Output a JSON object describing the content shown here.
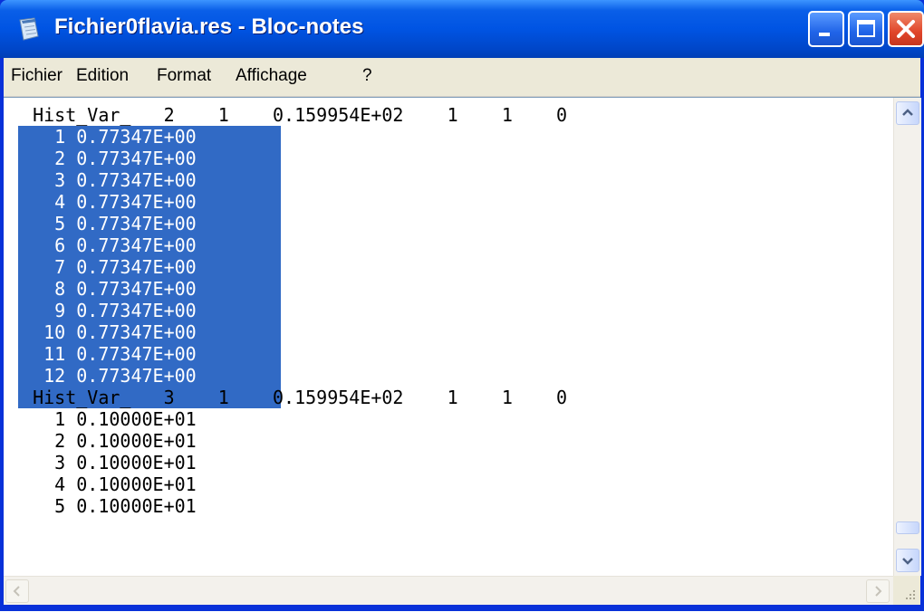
{
  "window": {
    "title": "Fichier0flavia.res - Bloc-notes",
    "controls": [
      "minimize",
      "maximize",
      "close"
    ]
  },
  "menu": {
    "items": [
      "Fichier",
      "Edition",
      "Format",
      "Affichage",
      "?"
    ]
  },
  "editor": {
    "lines": [
      "  Hist_Var_   2    1    0.159954E+02    1    1    0",
      "    1 0.77347E+00",
      "    2 0.77347E+00",
      "    3 0.77347E+00",
      "    4 0.77347E+00",
      "    5 0.77347E+00",
      "    6 0.77347E+00",
      "    7 0.77347E+00",
      "    8 0.77347E+00",
      "    9 0.77347E+00",
      "   10 0.77347E+00",
      "   11 0.77347E+00",
      "   12 0.77347E+00",
      "  Hist_Var_   3    1    0.159954E+02    1    1    0",
      "    1 0.10000E+01",
      "    2 0.10000E+01",
      "    3 0.10000E+01",
      "    4 0.10000E+01",
      "    5 0.10000E+01"
    ],
    "selected_line_indices": [
      1,
      2,
      3,
      4,
      5,
      6,
      7,
      8,
      9,
      10,
      11,
      12
    ]
  },
  "colors": {
    "selection_bg": "#316ac5",
    "selection_text": "#ffffff",
    "titlebar": "#0054e3"
  },
  "icons": {
    "app": "notepad-icon",
    "scroll_up": "arrow-up-icon",
    "scroll_down": "arrow-down-icon",
    "scroll_left": "arrow-left-icon",
    "scroll_right": "arrow-right-icon"
  }
}
